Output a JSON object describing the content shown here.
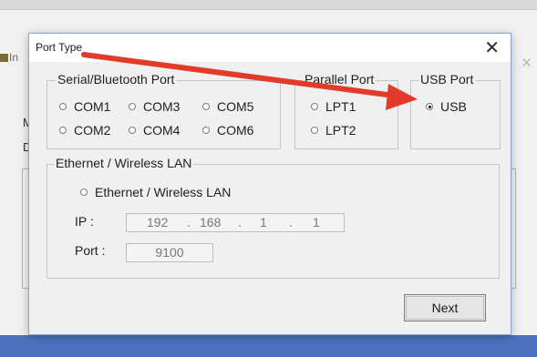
{
  "background_window": {
    "title_fragment": "In",
    "letters": [
      "M",
      "D"
    ]
  },
  "dialog": {
    "title": "Port Type",
    "close_glyph": "✕",
    "serial_group": {
      "legend": "Serial/Bluetooth Port",
      "options": [
        "COM1",
        "COM3",
        "COM5",
        "COM2",
        "COM4",
        "COM6"
      ]
    },
    "parallel_group": {
      "legend": "Parallel Port",
      "options": [
        "LPT1",
        "LPT2"
      ]
    },
    "usb_group": {
      "legend": "USB Port",
      "option": "USB",
      "selected": true
    },
    "ethernet_group": {
      "legend": "Ethernet  / Wireless LAN",
      "option": "Ethernet  / Wireless LAN",
      "ip_label": "IP :",
      "ip_segments": [
        "192",
        "168",
        "1",
        "1"
      ],
      "port_label": "Port :",
      "port_value": "9100"
    },
    "next_button": "Next"
  },
  "colors": {
    "annotation_arrow": "#e23b2a",
    "taskbar": "#4b73bd"
  }
}
